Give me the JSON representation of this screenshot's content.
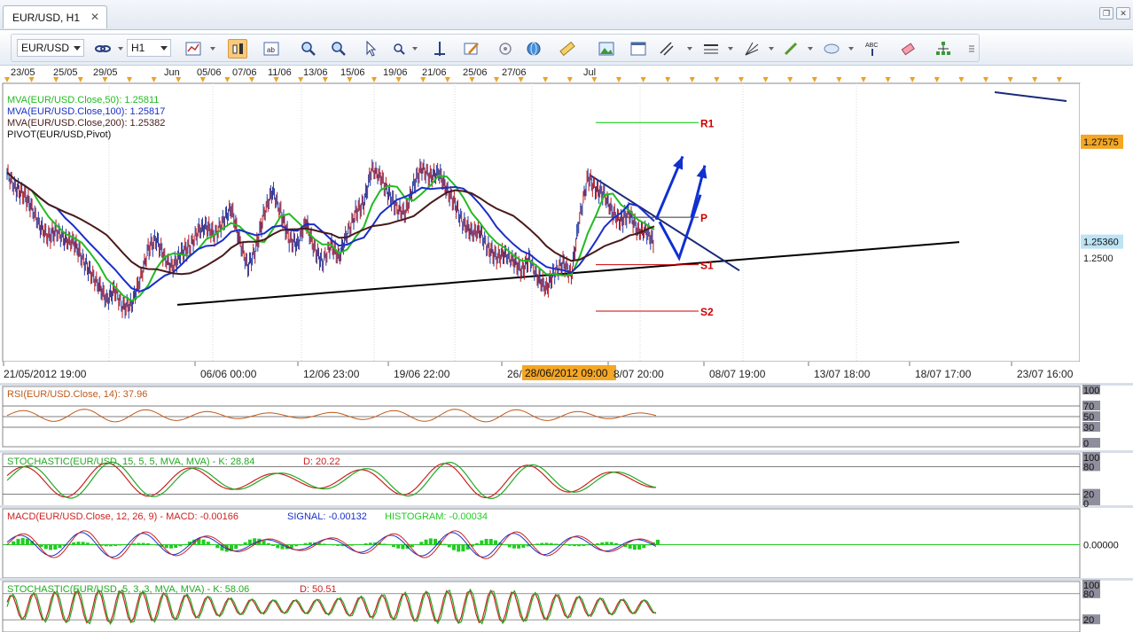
{
  "tab": {
    "label": "EUR/USD, H1"
  },
  "toolbar": {
    "symbol": "EUR/USD",
    "timeframe": "H1"
  },
  "chart_data": {
    "type": "line",
    "instrument": "EUR/USD",
    "timeframe": "H1",
    "date_labels_top": [
      "23/05",
      "25/05",
      "29/05",
      "Jun",
      "05/06",
      "07/06",
      "11/06",
      "13/06",
      "15/06",
      "19/06",
      "21/06",
      "25/06",
      "27/06",
      "Jul"
    ],
    "time_axis_labels": [
      "21/05/2012 19:00",
      "06/06 00:00",
      "12/06 23:00",
      "19/06 22:00",
      "26/",
      "8/07 20:00",
      "08/07 19:00",
      "13/07 18:00",
      "18/07 17:00",
      "23/07 16:00"
    ],
    "time_cursor_label": "28/06/2012 09:00",
    "price_ticks": [
      "1.2500"
    ],
    "price_labels": [
      {
        "text": "1.27575",
        "value": 1.27575,
        "color": "#f5a623"
      },
      {
        "text": "1.25360",
        "value": 1.2536,
        "color": "#bde3f5"
      }
    ],
    "ylim": [
      1.227,
      1.2887
    ],
    "legend": [
      {
        "text": "MVA(EUR/USD.Close,50): 1.25811",
        "color": "#22bb22"
      },
      {
        "text": "MVA(EUR/USD.Close,100): 1.25817",
        "color": "#1a2fc8"
      },
      {
        "text": "MVA(EUR/USD.Close,200): 1.25382",
        "color": "#4a1a1a"
      },
      {
        "text": "PIVOT(EUR/USD,Pivot)",
        "color": "#111111"
      }
    ],
    "pivot_levels": [
      {
        "name": "R1",
        "value": 1.28,
        "color": "#00cc00"
      },
      {
        "name": "P",
        "value": 1.259,
        "color": "#333333"
      },
      {
        "name": "S1",
        "value": 1.2485,
        "color": "#cc0000"
      },
      {
        "name": "S2",
        "value": 1.2382,
        "color": "#cc0000"
      }
    ],
    "price_path": [
      1.269,
      1.2655,
      1.264,
      1.261,
      1.257,
      1.2545,
      1.256,
      1.254,
      1.2535,
      1.25,
      1.247,
      1.244,
      1.2405,
      1.243,
      1.239,
      1.2395,
      1.245,
      1.252,
      1.254,
      1.25,
      1.248,
      1.251,
      1.2525,
      1.256,
      1.257,
      1.255,
      1.258,
      1.261,
      1.254,
      1.248,
      1.252,
      1.26,
      1.265,
      1.26,
      1.254,
      1.253,
      1.258,
      1.252,
      1.249,
      1.253,
      1.25,
      1.2555,
      1.26,
      1.262,
      1.27,
      1.268,
      1.264,
      1.261,
      1.26,
      1.266,
      1.27,
      1.268,
      1.269,
      1.265,
      1.262,
      1.2575,
      1.2555,
      1.256,
      1.252,
      1.25,
      1.251,
      1.2495,
      1.247,
      1.25,
      1.2455,
      1.243,
      1.247,
      1.249,
      1.246,
      1.259,
      1.268,
      1.265,
      1.264,
      1.26,
      1.258,
      1.26,
      1.256,
      1.256,
      1.253
    ]
  },
  "indicators": [
    {
      "label": "RSI(EUR/USD.Close, 14): 37.96",
      "color": "#c05a1a",
      "ticks": [
        "100",
        "70",
        "50",
        "30",
        "0"
      ]
    },
    {
      "label": "STOCHASTIC(EUR/USD, 15, 5, 5, MVA, MVA) - K: 28.84",
      "label_d": "D: 20.22",
      "color": "#22aa22",
      "color_d": "#cc2222",
      "ticks": [
        "100",
        "80",
        "20",
        "0"
      ]
    },
    {
      "label": "MACD(EUR/USD.Close, 12, 26, 9) -  MACD: -0.00166",
      "label_signal": "SIGNAL: -0.00132",
      "label_hist": "HISTOGRAM: -0.00034",
      "color": "#cc2222",
      "color_signal": "#1a2fc8",
      "color_hist": "#22cc22",
      "ticks": [
        "0.00000"
      ]
    },
    {
      "label": "STOCHASTIC(EUR/USD, 5, 3, 3, MVA, MVA) - K: 58.06",
      "label_d": "D: 50.51",
      "color": "#22aa22",
      "color_d": "#cc2222",
      "ticks": [
        "100",
        "80",
        "20"
      ]
    }
  ]
}
